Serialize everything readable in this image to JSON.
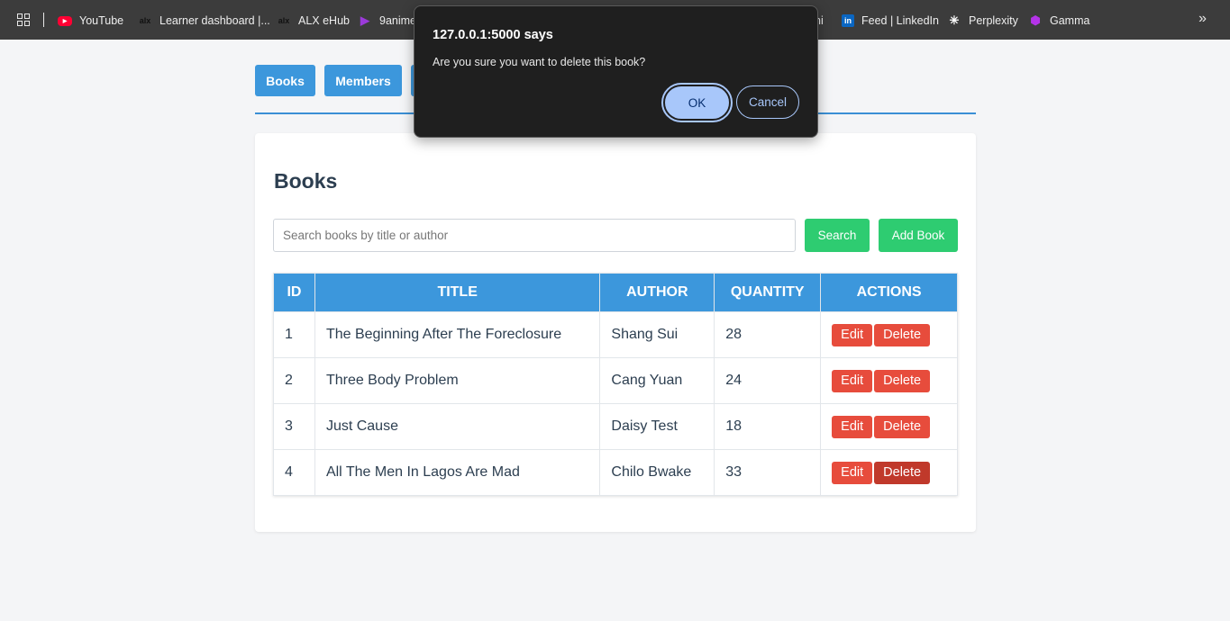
{
  "bookmarks": {
    "items": [
      {
        "label": "YouTube",
        "icon": "youtube-icon"
      },
      {
        "label": "Learner dashboard |...",
        "icon": "alx-icon"
      },
      {
        "label": "ALX eHub",
        "icon": "alx-icon"
      },
      {
        "label": "9anime",
        "icon": "play-icon"
      },
      {
        "label": "ni",
        "icon": ""
      },
      {
        "label": "Feed | LinkedIn",
        "icon": "linkedin-icon"
      },
      {
        "label": "Perplexity",
        "icon": "perplexity-icon"
      },
      {
        "label": "Gamma",
        "icon": "gamma-icon"
      }
    ],
    "more": "»"
  },
  "nav": {
    "books": "Books",
    "members": "Members"
  },
  "page": {
    "title": "Books",
    "search_placeholder": "Search books by title or author",
    "search_button": "Search",
    "add_button": "Add Book"
  },
  "table": {
    "headers": [
      "ID",
      "TITLE",
      "AUTHOR",
      "QUANTITY",
      "ACTIONS"
    ],
    "rows": [
      {
        "id": "1",
        "title": "The Beginning After The Foreclosure",
        "author": "Shang Sui",
        "quantity": "28"
      },
      {
        "id": "2",
        "title": "Three Body Problem",
        "author": "Cang Yuan",
        "quantity": "24"
      },
      {
        "id": "3",
        "title": "Just Cause",
        "author": "Daisy Test",
        "quantity": "18"
      },
      {
        "id": "4",
        "title": "All The Men In Lagos Are Mad",
        "author": "Chilo Bwake",
        "quantity": "33"
      }
    ],
    "edit_label": "Edit",
    "delete_label": "Delete"
  },
  "dialog": {
    "title": "127.0.0.1:5000 says",
    "message": "Are you sure you want to delete this book?",
    "ok": "OK",
    "cancel": "Cancel"
  },
  "colors": {
    "primary": "#3c97dc",
    "success": "#2ecc71",
    "danger": "#e74c3c",
    "danger_active": "#c0392b"
  }
}
